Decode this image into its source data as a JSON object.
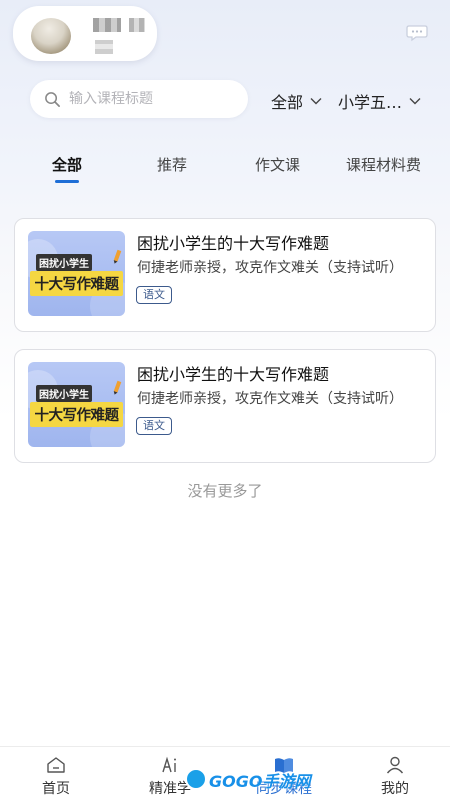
{
  "search": {
    "placeholder": "输入课程标题"
  },
  "filters": {
    "category": "全部",
    "grade": "小学五…"
  },
  "tabs": [
    "全部",
    "推荐",
    "作文课",
    "课程材料费"
  ],
  "courses": [
    {
      "title": "困扰小学生的十大写作难题",
      "description": "何捷老师亲授，攻克作文难关（支持试听）",
      "tag": "语文",
      "thumb_top": "困扰小学生",
      "thumb_main": "十大写作难题"
    },
    {
      "title": "困扰小学生的十大写作难题",
      "description": "何捷老师亲授，攻克作文难关（支持试听）",
      "tag": "语文",
      "thumb_top": "困扰小学生",
      "thumb_main": "十大写作难题"
    }
  ],
  "list_end_text": "没有更多了",
  "bottom_nav": [
    {
      "label": "首页",
      "icon": "home-icon"
    },
    {
      "label": "精准学",
      "icon": "ai-icon"
    },
    {
      "label": "同步课程",
      "icon": "book-icon",
      "active": true
    },
    {
      "label": "我的",
      "icon": "user-icon"
    }
  ],
  "watermark": "GOGO手游网",
  "colors": {
    "accent": "#1e6ed6",
    "tag_border": "#3c5a8c",
    "thumb_bg": "#b7c8f5",
    "thumb_highlight": "#f5d742"
  }
}
